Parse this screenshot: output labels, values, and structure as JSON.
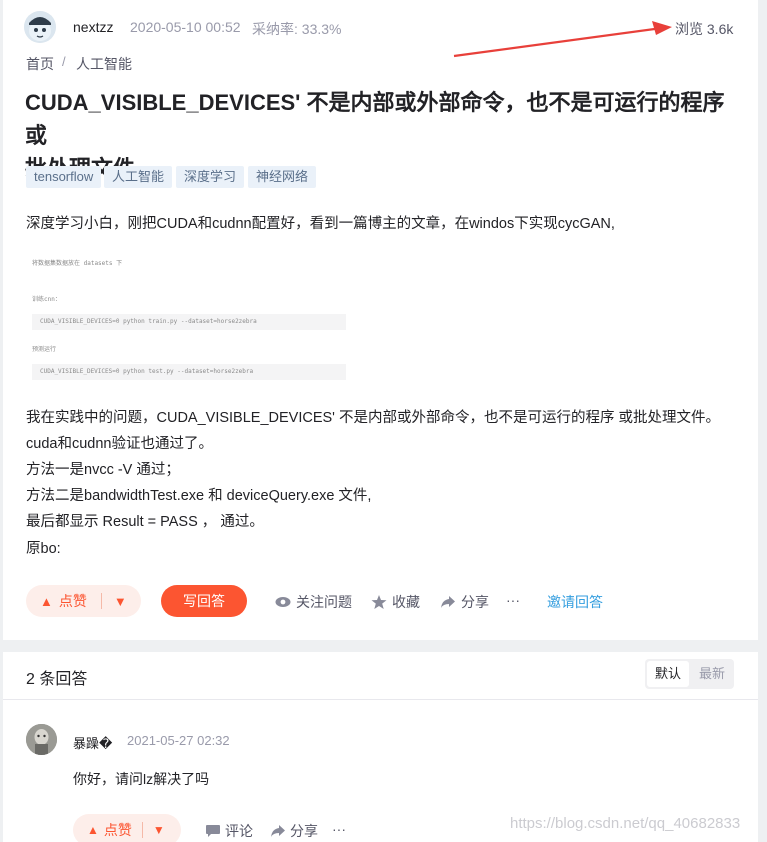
{
  "question": {
    "author": "nextzz",
    "time": "2020-05-10 00:52",
    "accept_rate": "采纳率: 33.3%",
    "views": "浏览 3.6k",
    "breadcrumb": [
      "首页",
      "人工智能"
    ],
    "breadcrumb_sep": "/",
    "title_line1": "CUDA_VISIBLE_DEVICES' 不是内部或外部命令，也不是可运行的程序 或",
    "title_line2": "批处理文件。",
    "tags": [
      "tensorflow",
      "人工智能",
      "深度学习",
      "神经网络"
    ],
    "intro": "深度学习小白，刚把CUDA和cudnn配置好，看到一篇博主的文章，在windos下实现cycGAN,",
    "embedded_screenshot": {
      "line1": "将数据集数据放在 datasets 下",
      "line2": "训练cnn：",
      "cmd1": "CUDA_VISIBLE_DEVICES=0 python train.py --dataset=horse2zebra",
      "line3": "预测运行",
      "cmd2": "CUDA_VISIBLE_DEVICES=0 python test.py --dataset=horse2zebra"
    },
    "body_lines": [
      "我在实践中的问题，CUDA_VISIBLE_DEVICES' 不是内部或外部命令，也不是可运行的程序 或批处理文件。",
      "cuda和cudnn验证也通过了。",
      "方法一是nvcc -V 通过；",
      "方法二是bandwidthTest.exe 和 deviceQuery.exe 文件,",
      "最后都显示 Result = PASS ， 通过。",
      "原bo:"
    ],
    "actions": {
      "like": "点赞",
      "answer": "写回答",
      "follow": "关注问题",
      "collect": "收藏",
      "share": "分享",
      "more": "···",
      "invite": "邀请回答"
    }
  },
  "answers": {
    "count_label": "2 条回答",
    "sort_default": "默认",
    "sort_newest": "最新",
    "items": [
      {
        "author": "暴躁�",
        "time": "2021-05-27 02:32",
        "text": "你好，请问lz解决了吗",
        "like": "点赞",
        "comment": "评论",
        "share": "分享",
        "more": "···"
      }
    ]
  },
  "watermark": "https://blog.csdn.net/qq_40682833",
  "colors": {
    "accent": "#fc5531",
    "link": "#349edf",
    "tag_bg": "#eaf1f9",
    "arrow": "#e8403a"
  },
  "icons": [
    "eye-icon",
    "star-icon",
    "share-arrow-icon",
    "comment-icon",
    "thumb-up-icon",
    "thumb-down-icon"
  ]
}
